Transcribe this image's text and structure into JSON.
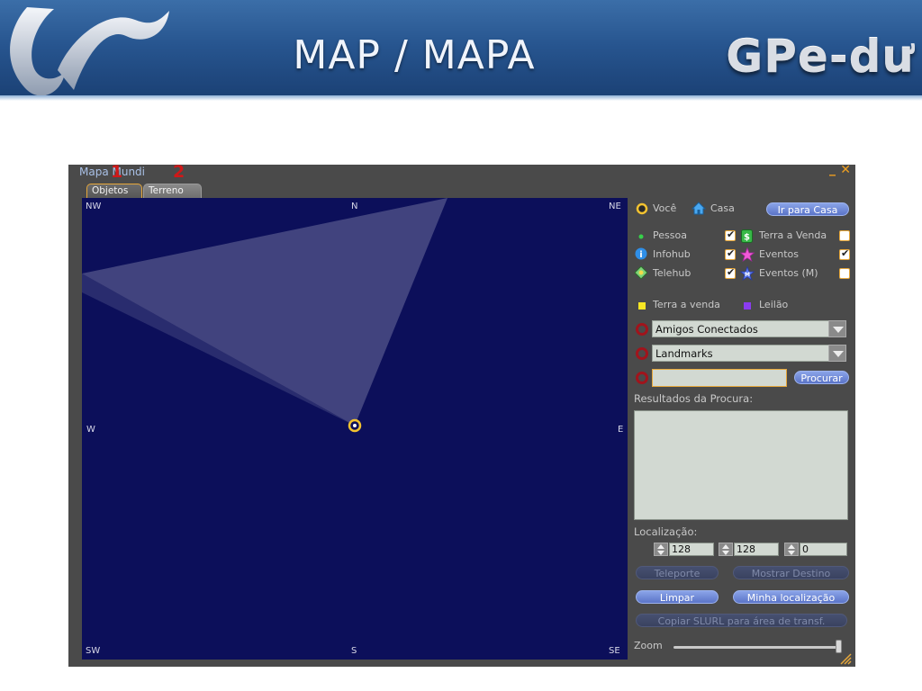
{
  "banner": {
    "title": "MAP / MAPA",
    "brand": "GPe-dư"
  },
  "window": {
    "title": "Mapa Mundi",
    "minimize_glyph": "_",
    "close_glyph": "✕",
    "annotations": [
      "1",
      "2"
    ],
    "tabs": [
      {
        "label": "Objetos",
        "active": true
      },
      {
        "label": "Terreno",
        "active": false
      }
    ]
  },
  "map": {
    "compass": {
      "nw": "NW",
      "n": "N",
      "ne": "NE",
      "w": "W",
      "e": "E",
      "sw": "SW",
      "s": "S",
      "se": "SE"
    },
    "background_color": "#0c0f5a"
  },
  "panel": {
    "you_label": "Você",
    "home_label": "Casa",
    "go_home_button": "Ir para Casa",
    "legend": [
      {
        "label": "Pessoa",
        "icon": "person-dot-icon",
        "checked": true
      },
      {
        "label": "Infohub",
        "icon": "info-icon",
        "checked": true
      },
      {
        "label": "Telehub",
        "icon": "telehub-icon",
        "checked": true
      },
      {
        "label": "Terra a Venda",
        "icon": "land-sale-icon",
        "checked": false
      },
      {
        "label": "Eventos",
        "icon": "event-star-icon",
        "checked": true
      },
      {
        "label": "Eventos (M)",
        "icon": "event-mature-icon",
        "checked": false
      }
    ],
    "land_for_sale_label": "Terra a venda",
    "auction_label": "Leilão",
    "land_color": "#f7e624",
    "auction_color": "#8b3cf0",
    "friends_combo": "Amigos Conectados",
    "landmarks_combo": "Landmarks",
    "search_value": "",
    "search_button": "Procurar",
    "results_label": "Resultados da Procura:",
    "location_label": "Localização:",
    "coords": {
      "x": "128",
      "y": "128",
      "z": "0"
    },
    "teleport_button": "Teleporte",
    "show_destination_button": "Mostrar Destino",
    "clear_button": "Limpar",
    "my_location_button": "Minha localização",
    "copy_slurl_button": "Copiar SLURL para área de transf.",
    "zoom_label": "Zoom"
  }
}
